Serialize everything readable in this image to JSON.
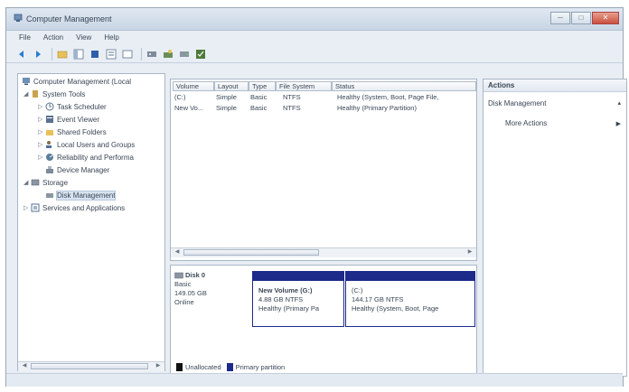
{
  "window": {
    "title": "Computer Management",
    "controls": {
      "minimize": "─",
      "maximize": "□",
      "close": "✕"
    }
  },
  "menu": [
    "File",
    "Action",
    "View",
    "Help"
  ],
  "toolbar": {
    "icons": [
      "back-icon",
      "forward-icon",
      "up-folder-icon",
      "show-hide-tree-icon",
      "refresh-icon",
      "properties-icon",
      "help-icon",
      "connect-icon",
      "rescan-icon",
      "disk-icon",
      "check-icon"
    ]
  },
  "tree": {
    "root": "Computer Management (Local",
    "system_tools": "System Tools",
    "task_scheduler": "Task Scheduler",
    "event_viewer": "Event Viewer",
    "shared_folders": "Shared Folders",
    "local_users": "Local Users and Groups",
    "reliability": "Reliability and Performa",
    "device_manager": "Device Manager",
    "storage": "Storage",
    "disk_management": "Disk Management",
    "services": "Services and Applications"
  },
  "volumes": {
    "columns": [
      "Volume",
      "Layout",
      "Type",
      "File System",
      "Status"
    ],
    "rows": [
      [
        "(C:)",
        "Simple",
        "Basic",
        "NTFS",
        "Healthy (System, Boot, Page File,"
      ],
      [
        "New Vo...",
        "Simple",
        "Basic",
        "NTFS",
        "Healthy (Primary Partition)"
      ]
    ]
  },
  "disk": {
    "name": "Disk 0",
    "type": "Basic",
    "size": "149.05 GB",
    "state": "Online",
    "partitions": [
      {
        "title": "New Volume (G:)",
        "size": "4.88 GB NTFS",
        "status": "Healthy (Primary Pa"
      },
      {
        "title": "(C:)",
        "size": "144.17 GB NTFS",
        "status": "Healthy (System, Boot, Page"
      }
    ],
    "legend": [
      {
        "label": "Unallocated",
        "color": "#111111"
      },
      {
        "label": "Primary partition",
        "color": "#1d2a8a"
      }
    ]
  },
  "actions": {
    "header": "Actions",
    "section": "Disk Management",
    "more": "More Actions"
  },
  "colors": {
    "accent": "#1d2a8a",
    "selection": "#d8e4f0"
  }
}
